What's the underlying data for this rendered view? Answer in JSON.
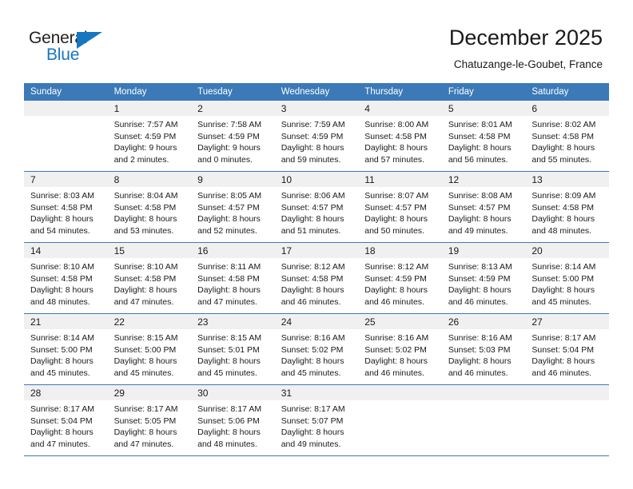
{
  "brand": {
    "name_top": "General",
    "name_bottom": "Blue",
    "accent_color": "#1676c0",
    "triangle_icon": "triangle-icon"
  },
  "header": {
    "title": "December 2025",
    "subtitle": "Chatuzange-le-Goubet, France"
  },
  "theme": {
    "header_row_bg": "#3b79b7",
    "daynum_band_bg": "#f0f0f0",
    "row_divider": "#3b79b7",
    "text": "#1a1a1a"
  },
  "weekday_headers": [
    "Sunday",
    "Monday",
    "Tuesday",
    "Wednesday",
    "Thursday",
    "Friday",
    "Saturday"
  ],
  "weeks": [
    [
      {
        "day": "",
        "sunrise": "",
        "sunset": "",
        "daylight_line1": "",
        "daylight_line2": ""
      },
      {
        "day": "1",
        "sunrise": "Sunrise: 7:57 AM",
        "sunset": "Sunset: 4:59 PM",
        "daylight_line1": "Daylight: 9 hours",
        "daylight_line2": "and 2 minutes."
      },
      {
        "day": "2",
        "sunrise": "Sunrise: 7:58 AM",
        "sunset": "Sunset: 4:59 PM",
        "daylight_line1": "Daylight: 9 hours",
        "daylight_line2": "and 0 minutes."
      },
      {
        "day": "3",
        "sunrise": "Sunrise: 7:59 AM",
        "sunset": "Sunset: 4:59 PM",
        "daylight_line1": "Daylight: 8 hours",
        "daylight_line2": "and 59 minutes."
      },
      {
        "day": "4",
        "sunrise": "Sunrise: 8:00 AM",
        "sunset": "Sunset: 4:58 PM",
        "daylight_line1": "Daylight: 8 hours",
        "daylight_line2": "and 57 minutes."
      },
      {
        "day": "5",
        "sunrise": "Sunrise: 8:01 AM",
        "sunset": "Sunset: 4:58 PM",
        "daylight_line1": "Daylight: 8 hours",
        "daylight_line2": "and 56 minutes."
      },
      {
        "day": "6",
        "sunrise": "Sunrise: 8:02 AM",
        "sunset": "Sunset: 4:58 PM",
        "daylight_line1": "Daylight: 8 hours",
        "daylight_line2": "and 55 minutes."
      }
    ],
    [
      {
        "day": "7",
        "sunrise": "Sunrise: 8:03 AM",
        "sunset": "Sunset: 4:58 PM",
        "daylight_line1": "Daylight: 8 hours",
        "daylight_line2": "and 54 minutes."
      },
      {
        "day": "8",
        "sunrise": "Sunrise: 8:04 AM",
        "sunset": "Sunset: 4:58 PM",
        "daylight_line1": "Daylight: 8 hours",
        "daylight_line2": "and 53 minutes."
      },
      {
        "day": "9",
        "sunrise": "Sunrise: 8:05 AM",
        "sunset": "Sunset: 4:57 PM",
        "daylight_line1": "Daylight: 8 hours",
        "daylight_line2": "and 52 minutes."
      },
      {
        "day": "10",
        "sunrise": "Sunrise: 8:06 AM",
        "sunset": "Sunset: 4:57 PM",
        "daylight_line1": "Daylight: 8 hours",
        "daylight_line2": "and 51 minutes."
      },
      {
        "day": "11",
        "sunrise": "Sunrise: 8:07 AM",
        "sunset": "Sunset: 4:57 PM",
        "daylight_line1": "Daylight: 8 hours",
        "daylight_line2": "and 50 minutes."
      },
      {
        "day": "12",
        "sunrise": "Sunrise: 8:08 AM",
        "sunset": "Sunset: 4:57 PM",
        "daylight_line1": "Daylight: 8 hours",
        "daylight_line2": "and 49 minutes."
      },
      {
        "day": "13",
        "sunrise": "Sunrise: 8:09 AM",
        "sunset": "Sunset: 4:58 PM",
        "daylight_line1": "Daylight: 8 hours",
        "daylight_line2": "and 48 minutes."
      }
    ],
    [
      {
        "day": "14",
        "sunrise": "Sunrise: 8:10 AM",
        "sunset": "Sunset: 4:58 PM",
        "daylight_line1": "Daylight: 8 hours",
        "daylight_line2": "and 48 minutes."
      },
      {
        "day": "15",
        "sunrise": "Sunrise: 8:10 AM",
        "sunset": "Sunset: 4:58 PM",
        "daylight_line1": "Daylight: 8 hours",
        "daylight_line2": "and 47 minutes."
      },
      {
        "day": "16",
        "sunrise": "Sunrise: 8:11 AM",
        "sunset": "Sunset: 4:58 PM",
        "daylight_line1": "Daylight: 8 hours",
        "daylight_line2": "and 47 minutes."
      },
      {
        "day": "17",
        "sunrise": "Sunrise: 8:12 AM",
        "sunset": "Sunset: 4:58 PM",
        "daylight_line1": "Daylight: 8 hours",
        "daylight_line2": "and 46 minutes."
      },
      {
        "day": "18",
        "sunrise": "Sunrise: 8:12 AM",
        "sunset": "Sunset: 4:59 PM",
        "daylight_line1": "Daylight: 8 hours",
        "daylight_line2": "and 46 minutes."
      },
      {
        "day": "19",
        "sunrise": "Sunrise: 8:13 AM",
        "sunset": "Sunset: 4:59 PM",
        "daylight_line1": "Daylight: 8 hours",
        "daylight_line2": "and 46 minutes."
      },
      {
        "day": "20",
        "sunrise": "Sunrise: 8:14 AM",
        "sunset": "Sunset: 5:00 PM",
        "daylight_line1": "Daylight: 8 hours",
        "daylight_line2": "and 45 minutes."
      }
    ],
    [
      {
        "day": "21",
        "sunrise": "Sunrise: 8:14 AM",
        "sunset": "Sunset: 5:00 PM",
        "daylight_line1": "Daylight: 8 hours",
        "daylight_line2": "and 45 minutes."
      },
      {
        "day": "22",
        "sunrise": "Sunrise: 8:15 AM",
        "sunset": "Sunset: 5:00 PM",
        "daylight_line1": "Daylight: 8 hours",
        "daylight_line2": "and 45 minutes."
      },
      {
        "day": "23",
        "sunrise": "Sunrise: 8:15 AM",
        "sunset": "Sunset: 5:01 PM",
        "daylight_line1": "Daylight: 8 hours",
        "daylight_line2": "and 45 minutes."
      },
      {
        "day": "24",
        "sunrise": "Sunrise: 8:16 AM",
        "sunset": "Sunset: 5:02 PM",
        "daylight_line1": "Daylight: 8 hours",
        "daylight_line2": "and 45 minutes."
      },
      {
        "day": "25",
        "sunrise": "Sunrise: 8:16 AM",
        "sunset": "Sunset: 5:02 PM",
        "daylight_line1": "Daylight: 8 hours",
        "daylight_line2": "and 46 minutes."
      },
      {
        "day": "26",
        "sunrise": "Sunrise: 8:16 AM",
        "sunset": "Sunset: 5:03 PM",
        "daylight_line1": "Daylight: 8 hours",
        "daylight_line2": "and 46 minutes."
      },
      {
        "day": "27",
        "sunrise": "Sunrise: 8:17 AM",
        "sunset": "Sunset: 5:04 PM",
        "daylight_line1": "Daylight: 8 hours",
        "daylight_line2": "and 46 minutes."
      }
    ],
    [
      {
        "day": "28",
        "sunrise": "Sunrise: 8:17 AM",
        "sunset": "Sunset: 5:04 PM",
        "daylight_line1": "Daylight: 8 hours",
        "daylight_line2": "and 47 minutes."
      },
      {
        "day": "29",
        "sunrise": "Sunrise: 8:17 AM",
        "sunset": "Sunset: 5:05 PM",
        "daylight_line1": "Daylight: 8 hours",
        "daylight_line2": "and 47 minutes."
      },
      {
        "day": "30",
        "sunrise": "Sunrise: 8:17 AM",
        "sunset": "Sunset: 5:06 PM",
        "daylight_line1": "Daylight: 8 hours",
        "daylight_line2": "and 48 minutes."
      },
      {
        "day": "31",
        "sunrise": "Sunrise: 8:17 AM",
        "sunset": "Sunset: 5:07 PM",
        "daylight_line1": "Daylight: 8 hours",
        "daylight_line2": "and 49 minutes."
      },
      {
        "day": "",
        "sunrise": "",
        "sunset": "",
        "daylight_line1": "",
        "daylight_line2": ""
      },
      {
        "day": "",
        "sunrise": "",
        "sunset": "",
        "daylight_line1": "",
        "daylight_line2": ""
      },
      {
        "day": "",
        "sunrise": "",
        "sunset": "",
        "daylight_line1": "",
        "daylight_line2": ""
      }
    ]
  ]
}
